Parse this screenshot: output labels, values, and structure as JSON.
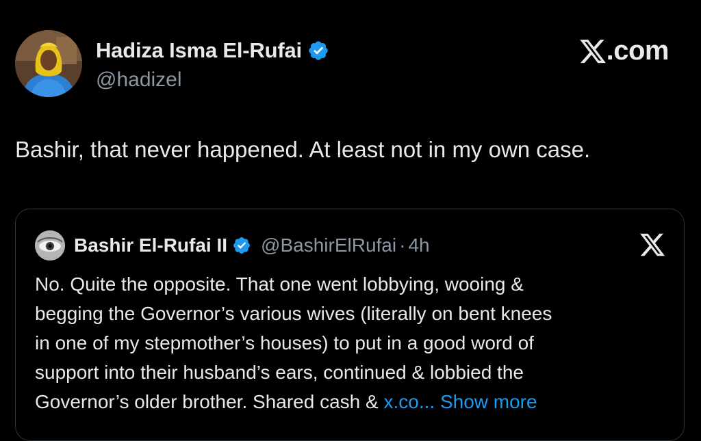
{
  "author": {
    "name": "Hadiza Isma El-Rufai",
    "handle": "@hadizel",
    "verified": true
  },
  "brand": {
    "logo": "x-logo-icon",
    "text": ".com"
  },
  "post": {
    "text": "Bashir, that never happened. At least not in my own case."
  },
  "quote": {
    "author_name": "Bashir El-Rufai II",
    "handle": "@BashirElRufai",
    "separator": "·",
    "time": "4h",
    "lines": [
      "No. Quite the opposite. That one went lobbying, wooing &",
      "begging the Governor’s various wives (literally on bent knees",
      "in one of my stepmother’s houses) to put in a good word of",
      "support into their husband’s ears, continued & lobbied the",
      "Governor’s older brother. Shared cash &"
    ],
    "truncated_link": "x.co...",
    "show_more": "Show more"
  },
  "colors": {
    "background": "#000000",
    "text": "#e7e9ea",
    "muted": "#8b98a5",
    "link": "#1d9bf0",
    "verified": "#1d9bf0",
    "border": "#2f3336"
  }
}
